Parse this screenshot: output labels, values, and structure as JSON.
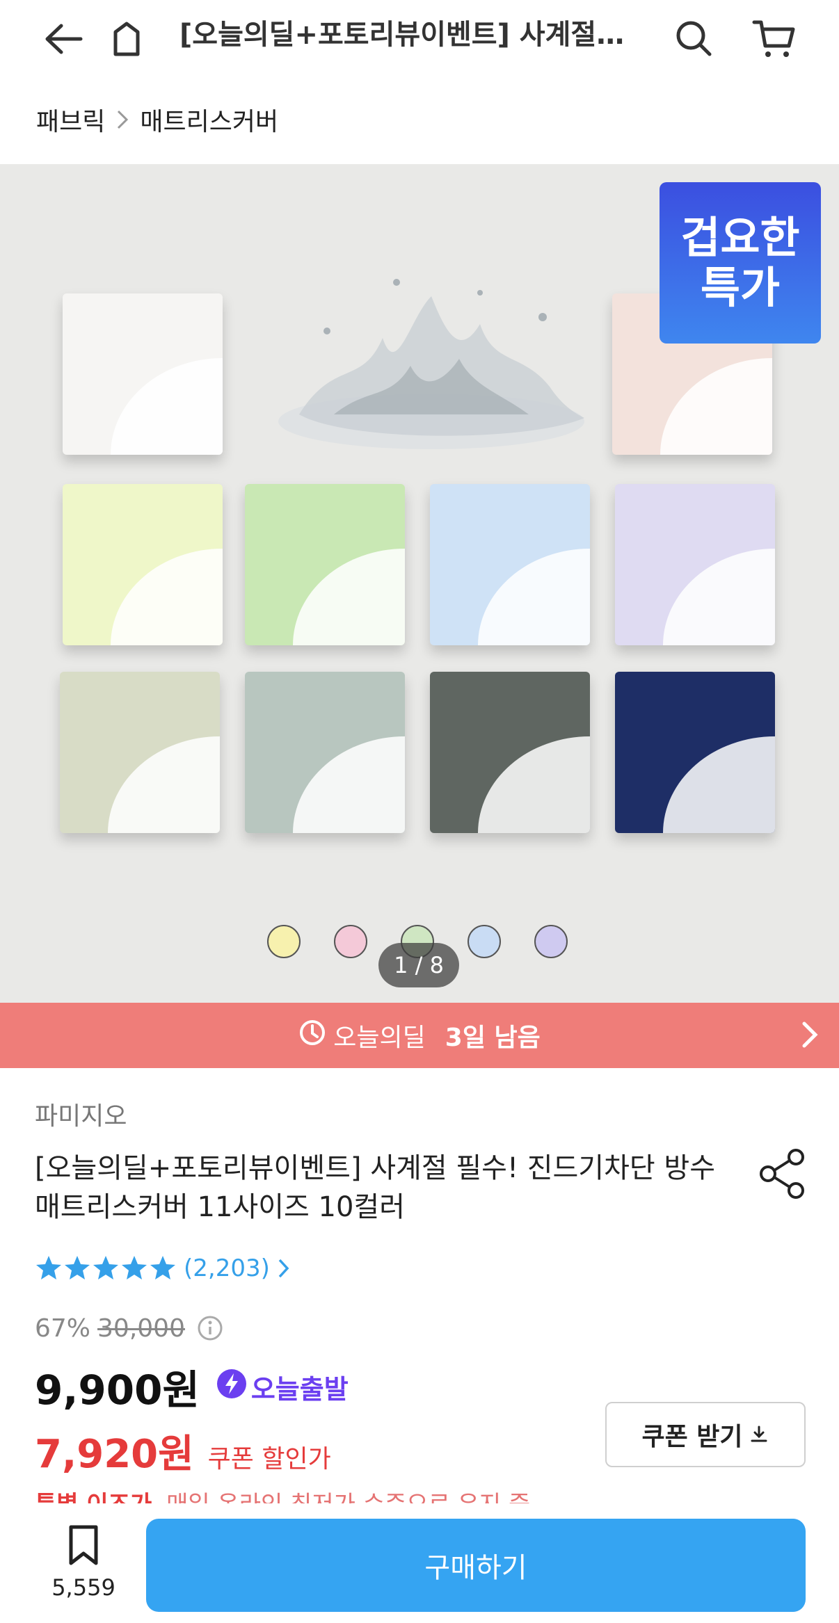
{
  "header": {
    "title": "[오늘의딜+포토리뷰이벤트] 사계절…",
    "icons": [
      "back-arrow-icon",
      "home-icon",
      "search-icon",
      "cart-icon"
    ]
  },
  "breadcrumb": {
    "items": [
      "패브릭",
      "매트리스커버"
    ]
  },
  "hero": {
    "badge_line1": "겁요한",
    "badge_line2": "특가",
    "pager": "1 / 8",
    "swatch_colors": [
      "#f7f1ae",
      "#f4c9d8",
      "#cfe6c2",
      "#c9dcf4",
      "#cfcaf0"
    ],
    "sheet_colors": [
      "#f6f5f3",
      "#f3e2dc",
      "#eff7c9",
      "#c9e8b4",
      "#cfe2f6",
      "#dfdbf2",
      "#d8dcc6",
      "#b8c6bf",
      "#5f6661",
      "#1e2e66"
    ]
  },
  "deal": {
    "label": "오늘의딜",
    "remaining": "3일 남음"
  },
  "product": {
    "brand": "파미지오",
    "title": "[오늘의딜+포토리뷰이벤트] 사계절 필수! 진드기차단 방수 매트리스커버 11사이즈 10컬러",
    "review_count": "(2,203)",
    "discount": "67%",
    "original_price": "30,000",
    "price": "9,900원",
    "shipping_badge": "오늘출발",
    "coupon_price": "7,920원",
    "coupon_price_label": "쿠폰 할인가",
    "coupon_button": "쿠폰 받기",
    "special_tag": "특별 이즈가",
    "special_text": "매일 온라인 최저가 수준으로 유지 중"
  },
  "bottom": {
    "bookmark_count": "5,559",
    "buy_label": "구매하기"
  },
  "colors": {
    "accent_blue": "#35a4f2",
    "deal_banner": "#ef7d79",
    "sale_red": "#e53b3b",
    "shipping_purple": "#6b3ff0",
    "star_blue": "#35a0e9"
  }
}
